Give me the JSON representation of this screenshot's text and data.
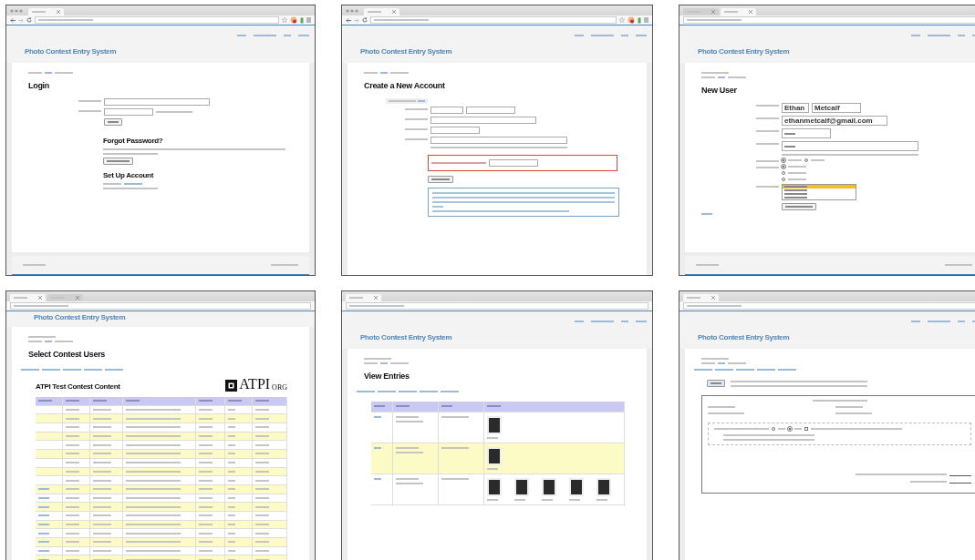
{
  "panels": [
    {
      "kind": "login",
      "window_controls": true,
      "toolbar_icons": true,
      "nav_menu": true,
      "tabs": [
        {
          "selected": true
        }
      ],
      "site_title": "Photo Contest Entry System",
      "heading": "Login",
      "subheadings": [
        "Forgot Password?",
        "Set Up Account"
      ],
      "footer": true
    },
    {
      "kind": "register",
      "window_controls": true,
      "toolbar_icons": true,
      "nav_menu": true,
      "tabs": [
        {
          "selected": true
        }
      ],
      "site_title": "Photo Contest Entry System",
      "heading": "Create a New Account",
      "footer": false
    },
    {
      "kind": "new_user",
      "window_controls": false,
      "toolbar_icons": false,
      "nav_menu": true,
      "tabs": [
        {
          "selected": false
        },
        {
          "selected": true
        }
      ],
      "site_title": "Photo Contest Entry System",
      "heading": "New User",
      "name_values": [
        "Ethan",
        "Metcalf"
      ],
      "email_value": "ethanmetcalf@gmail.com",
      "active_options": [
        {
          "selected": true
        },
        {
          "selected": false
        }
      ],
      "type_options": [
        {
          "selected": true
        },
        {
          "selected": false
        },
        {
          "selected": false
        }
      ],
      "instructor_options": [
        {
          "selected": true
        },
        {
          "selected": false
        },
        {
          "selected": false
        },
        {
          "selected": false
        }
      ],
      "footer": true
    },
    {
      "kind": "users",
      "window_controls": false,
      "toolbar_icons": false,
      "nav_menu": false,
      "tabs": [
        {
          "selected": true
        },
        {
          "selected": false
        }
      ],
      "site_title": "Photo Contest Entry System",
      "heading": "Select Contest Users",
      "contest_title": "ATPI Test Contest Content",
      "logo": {
        "text": "ATPI",
        "suffix": "ORG"
      },
      "rows": [
        {
          "editable": false
        },
        {
          "editable": false
        },
        {
          "editable": false
        },
        {
          "editable": false
        },
        {
          "editable": false
        },
        {
          "editable": false
        },
        {
          "editable": false
        },
        {
          "editable": false
        },
        {
          "editable": false
        },
        {
          "editable": true
        },
        {
          "editable": true
        },
        {
          "editable": true
        },
        {
          "editable": true
        },
        {
          "editable": true
        },
        {
          "editable": true
        },
        {
          "editable": true
        },
        {
          "editable": true
        },
        {
          "editable": true
        }
      ],
      "footer": false
    },
    {
      "kind": "entries",
      "window_controls": false,
      "toolbar_icons": false,
      "nav_menu": true,
      "tabs": [
        {
          "selected": true
        }
      ],
      "site_title": "Photo Contest Entry System",
      "heading": "View Entries",
      "rows": [
        {
          "previews": [
            {
              "kind": "photo"
            }
          ]
        },
        {
          "previews": [
            {
              "kind": "photo"
            }
          ]
        },
        {
          "previews": [
            {
              "kind": "photo"
            },
            {
              "kind": "photo"
            },
            {
              "kind": "photo"
            },
            {
              "kind": "photo"
            },
            {
              "kind": "photo"
            }
          ]
        }
      ],
      "footer": false
    },
    {
      "kind": "fees",
      "window_controls": false,
      "toolbar_icons": false,
      "nav_menu": true,
      "tabs": [
        {
          "selected": true
        }
      ],
      "site_title": "Photo Contest Entry System",
      "member_options": [
        {
          "selected": false
        },
        {
          "selected": true
        }
      ],
      "join_checked": false,
      "footer": false
    }
  ]
}
